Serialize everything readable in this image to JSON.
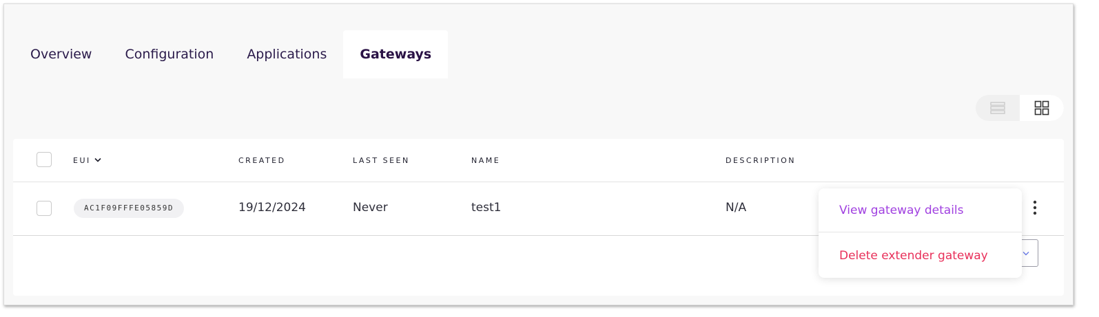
{
  "tabs": [
    {
      "label": "Overview",
      "active": false
    },
    {
      "label": "Configuration",
      "active": false
    },
    {
      "label": "Applications",
      "active": false
    },
    {
      "label": "Gateways",
      "active": true
    }
  ],
  "view_toggle": {
    "list_icon": "list-view-icon",
    "grid_icon": "grid-view-icon",
    "selected": "grid"
  },
  "table": {
    "columns": [
      "EUI",
      "CREATED",
      "LAST SEEN",
      "NAME",
      "DESCRIPTION"
    ],
    "sort_icon": "chevron-down-icon",
    "rows": [
      {
        "eui": "AC1F09FFFE05859D",
        "created": "19/12/2024",
        "last_seen": "Never",
        "name": "test1",
        "description": "N/A"
      }
    ]
  },
  "row_menu": {
    "items": [
      {
        "label": "View gateway details",
        "color": "#a040e0"
      },
      {
        "label": "Delete extender gateway",
        "color": "#e8305a"
      }
    ]
  },
  "colors": {
    "accent_purple": "#a040e0",
    "danger": "#e8305a",
    "tab_text": "#2a1a4a"
  }
}
